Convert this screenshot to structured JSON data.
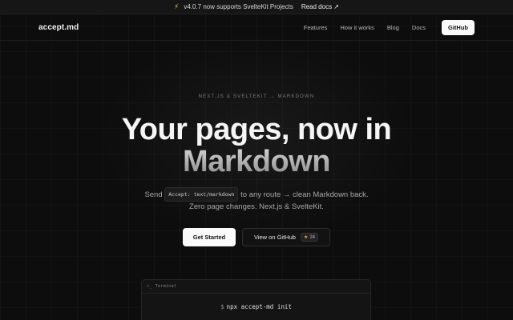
{
  "announcement": {
    "text": "v4.0.7 now supports SvelteKit Projects",
    "link": "Read docs ↗",
    "icon": "lightning-icon"
  },
  "nav": {
    "logo": "accept.md",
    "links": [
      "Features",
      "How it works",
      "Blog",
      "Docs"
    ],
    "github": "GitHub"
  },
  "hero": {
    "eyebrow": "NEXT.JS & SVELTEKIT → MARKDOWN",
    "title_line1": "Your pages, now in",
    "title_line2": "Markdown",
    "sub_before": "Send",
    "sub_code": "Accept: text/markdown",
    "sub_after": "to any route → clean Markdown back.",
    "sub_line2": "Zero page changes. Next.js & SvelteKit."
  },
  "cta": {
    "primary": "Get Started",
    "secondary": "View on GitHub",
    "stars": "24"
  },
  "terminal": {
    "title": "Terminal",
    "title_icon": "terminal-icon",
    "prompt": "$",
    "command": "npx accept-md init"
  },
  "colors": {
    "background": "#0d0d0d",
    "accent_star": "#e0b34a",
    "bolt": "#f5c542"
  }
}
